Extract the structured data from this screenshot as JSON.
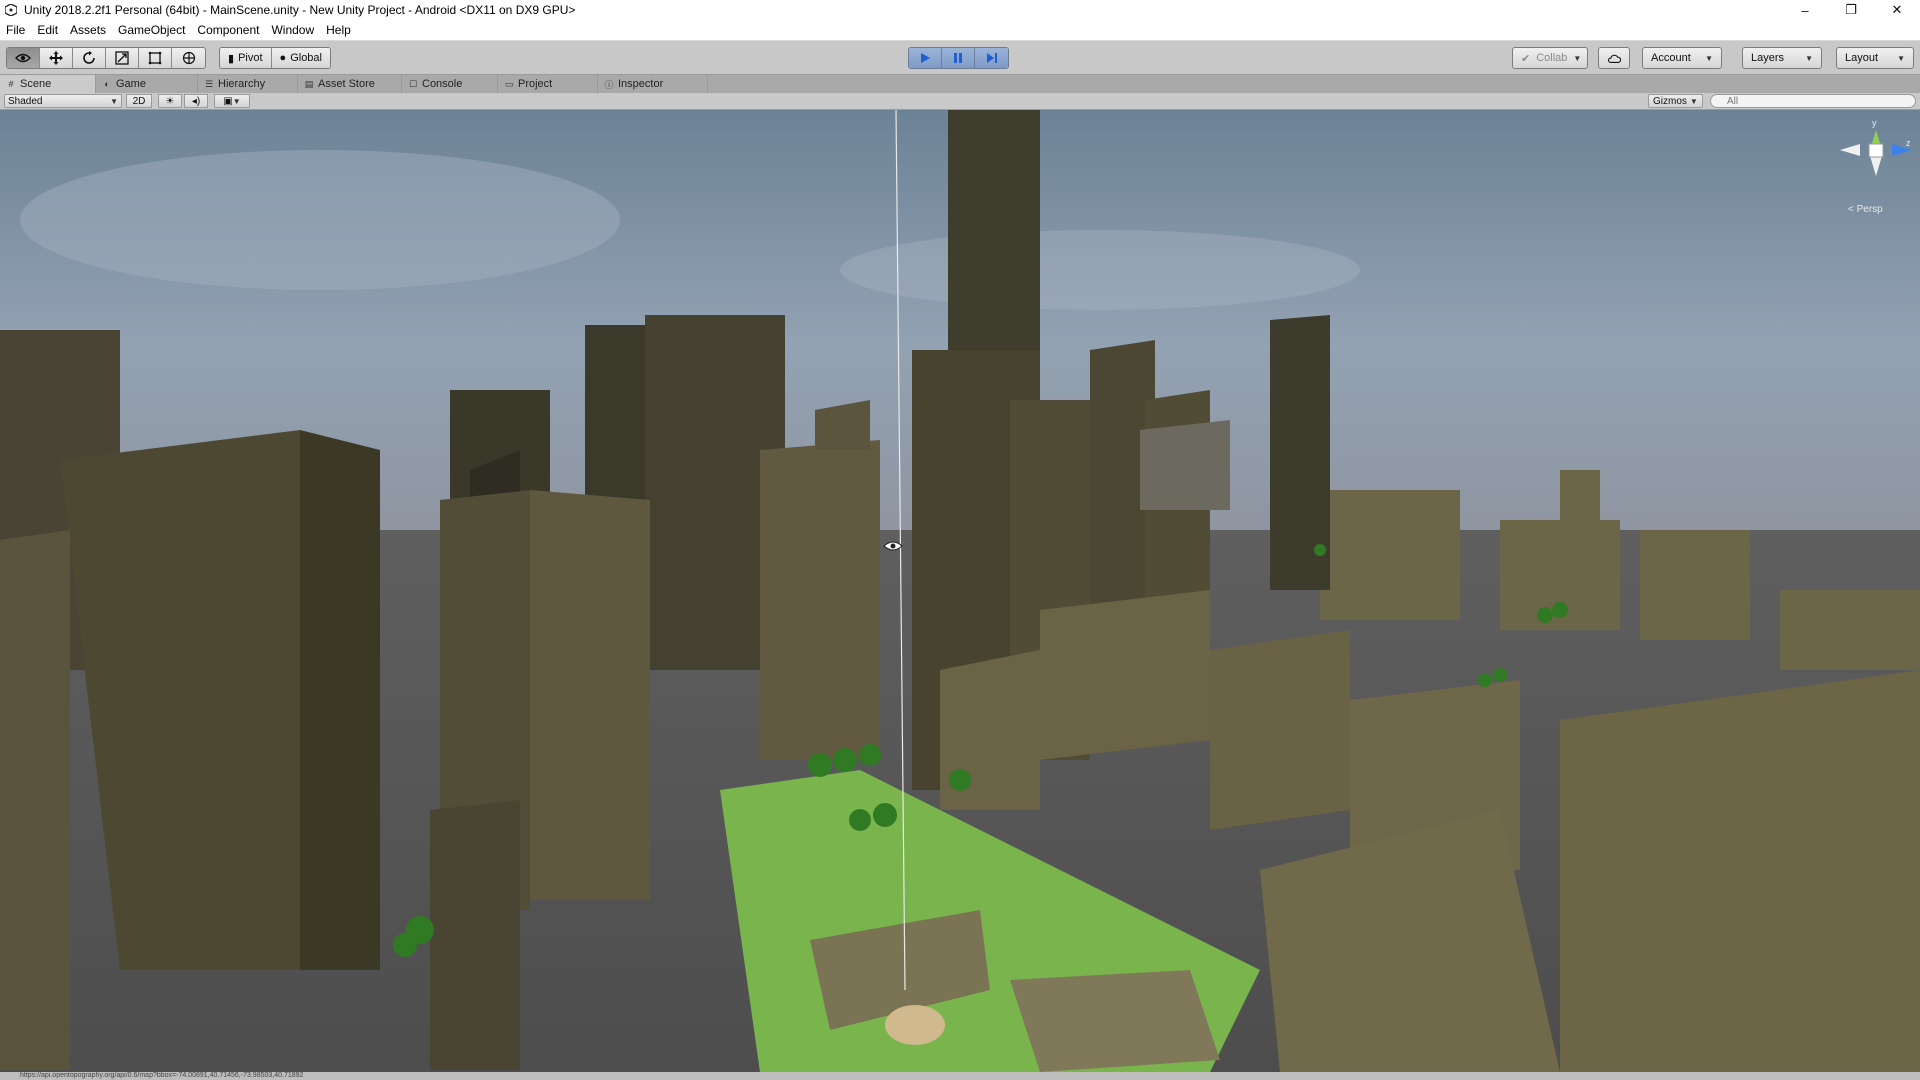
{
  "window": {
    "title": "Unity 2018.2.2f1 Personal (64bit) - MainScene.unity - New Unity Project - Android <DX11 on DX9 GPU>",
    "controls": {
      "minimize": "–",
      "maximize": "❐",
      "close": "✕"
    }
  },
  "menu": {
    "items": [
      {
        "label": "File"
      },
      {
        "label": "Edit"
      },
      {
        "label": "Assets"
      },
      {
        "label": "GameObject"
      },
      {
        "label": "Component"
      },
      {
        "label": "Window"
      },
      {
        "label": "Help"
      }
    ]
  },
  "toolbar": {
    "transform_tools": [
      "hand-icon",
      "move-icon",
      "rotate-icon",
      "scale-icon",
      "rect-icon",
      "transform-icon"
    ],
    "pivot_label": "Pivot",
    "global_label": "Global",
    "collab_label": "Collab",
    "account_label": "Account",
    "layers_label": "Layers",
    "layout_label": "Layout",
    "play_accent": "#2f6fd6"
  },
  "tabs": {
    "items": [
      {
        "label": "Scene",
        "icon": "scene-icon"
      },
      {
        "label": "Game",
        "icon": "game-icon"
      },
      {
        "label": "Hierarchy",
        "icon": "hierarchy-icon"
      },
      {
        "label": "Asset Store",
        "icon": "asset-store-icon"
      },
      {
        "label": "Console",
        "icon": "console-icon"
      },
      {
        "label": "Project",
        "icon": "folder-icon"
      },
      {
        "label": "Inspector",
        "icon": "info-icon"
      }
    ]
  },
  "scene": {
    "draw_mode": "Shaded",
    "mode_2d": "2D",
    "gizmos_label": "Gizmos",
    "search_placeholder": "All",
    "persp_label": "< Persp",
    "axis_y": "y",
    "axis_z": "z",
    "colors": {
      "sky": "#7d8fa3",
      "building": "#6a6547",
      "park": "#79b54c",
      "tree": "#2f7a22"
    }
  },
  "status": {
    "text": "https://api.opentopography.org/api/0.6/map?bbox=-74.00891,40.71456,-73.98503,40.71892"
  }
}
